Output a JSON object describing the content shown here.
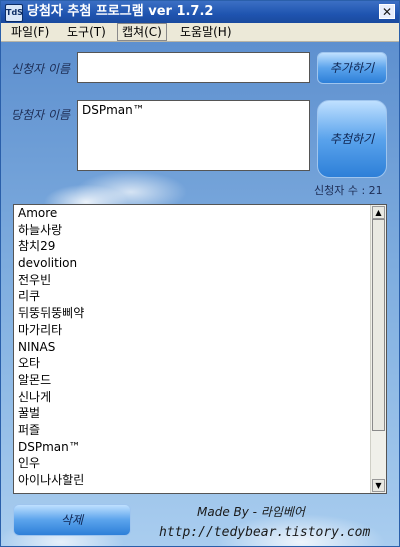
{
  "window": {
    "title": "당첨자 추첨 프로그램 ver 1.7.2",
    "icon_text": "TdS",
    "close_glyph": "✕"
  },
  "menu": {
    "items": [
      "파일(F)",
      "도구(T)",
      "캡쳐(C)",
      "도움말(H)"
    ]
  },
  "form": {
    "applicant_label": "신청자 이름",
    "applicant_value": "",
    "add_button": "추가하기",
    "winner_label": "당첨자 이름",
    "winner_value": "DSPman™",
    "draw_button": "추첨하기",
    "count_text": "신청자 수 : 21"
  },
  "list": {
    "items": [
      "Amore",
      "하늘사랑",
      "참치29",
      "devolition",
      "전우빈",
      "리쿠",
      "뒤뚱뒤뚱삐약",
      "마가리타",
      "NINAS",
      "오타",
      "알몬드",
      "신나게",
      "꿀벌",
      "퍼즐",
      "DSPman™",
      "인우",
      "아이나사할린"
    ],
    "scroll_up": "▲",
    "scroll_down": "▼"
  },
  "footer": {
    "delete_button": "삭제",
    "credit": "Made By - 라임베어",
    "url": "http://tedybear.tistory.com"
  },
  "colors": {
    "titlebar": "#1f54b0",
    "button": "#5aa3ec",
    "background": "#7aa7d8"
  }
}
